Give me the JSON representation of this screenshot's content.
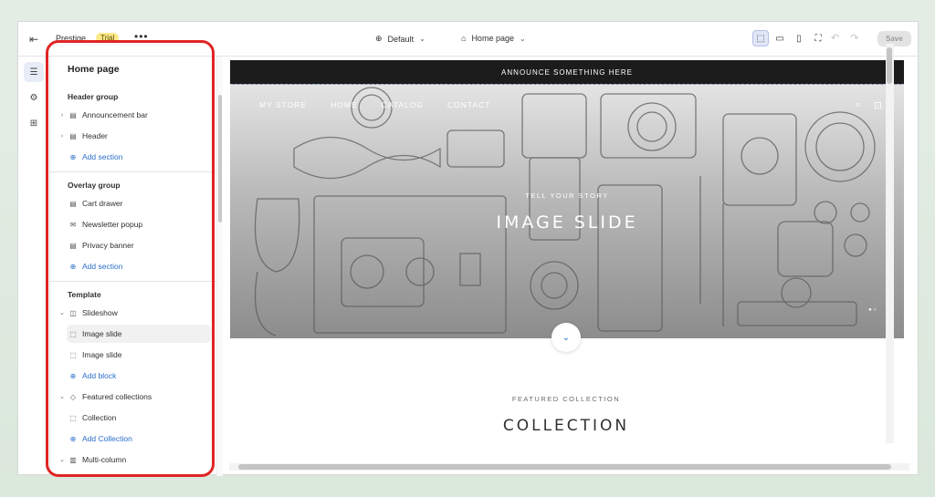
{
  "topbar": {
    "store_name": "Prestige",
    "trial_badge": "Trial",
    "more": "•••",
    "theme_label": "Default",
    "page_label": "Home page",
    "save_label": "Save"
  },
  "sidebar": {
    "title": "Home page",
    "header_group": {
      "title": "Header group",
      "items": [
        {
          "label": "Announcement bar",
          "icon": "layout-icon"
        },
        {
          "label": "Header",
          "icon": "layout-icon"
        }
      ],
      "add": "Add section"
    },
    "overlay_group": {
      "title": "Overlay group",
      "items": [
        {
          "label": "Cart drawer",
          "icon": "layout-icon"
        },
        {
          "label": "Newsletter popup",
          "icon": "mail-icon"
        },
        {
          "label": "Privacy banner",
          "icon": "layout-icon"
        }
      ],
      "add": "Add section"
    },
    "template": {
      "title": "Template",
      "slideshow": "Slideshow",
      "slides": [
        "Image slide",
        "Image slide"
      ],
      "add_block": "Add block",
      "featured": "Featured collections",
      "collection": "Collection",
      "add_collection": "Add Collection",
      "multi_column": "Multi-column"
    }
  },
  "preview": {
    "announcement": "ANNOUNCE SOMETHING HERE",
    "nav": [
      "MY STORE",
      "HOME",
      "CATALOG",
      "CONTACT"
    ],
    "hero_subtitle": "TELL YOUR STORY",
    "hero_title": "IMAGE SLIDE",
    "featured_subtitle": "FEATURED COLLECTION",
    "featured_title": "COLLECTION"
  },
  "colors": {
    "accent": "#2c6ecb",
    "highlight": "#e02424",
    "trial_badge": "#ffe88a"
  }
}
